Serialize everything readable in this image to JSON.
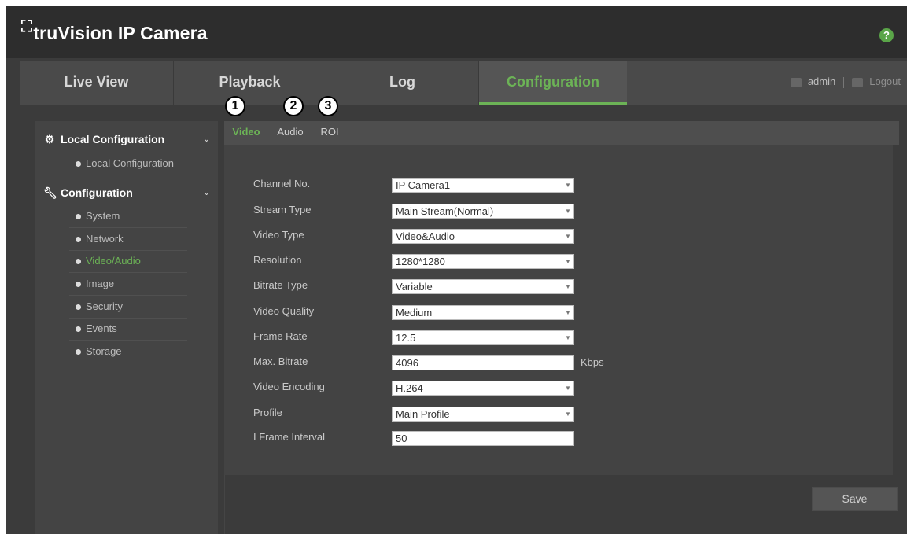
{
  "app": {
    "title": "truVision IP Camera",
    "logo_mark": "⛶",
    "help_icon": "?"
  },
  "nav": {
    "tabs": [
      "Live View",
      "Playback",
      "Log",
      "Configuration"
    ],
    "active_tab": "Configuration",
    "user": "admin",
    "logout": "Logout"
  },
  "callouts": [
    "1",
    "2",
    "3"
  ],
  "sidebar": {
    "groups": [
      {
        "label": "Local Configuration",
        "icon": "settings-icon",
        "items": [
          "Local Configuration"
        ]
      },
      {
        "label": "Configuration",
        "icon": "wrench-icon",
        "items": [
          "System",
          "Network",
          "Video/Audio",
          "Image",
          "Security",
          "Events",
          "Storage"
        ]
      }
    ],
    "active_item": "Video/Audio"
  },
  "subtabs": [
    "Video",
    "Audio",
    "ROI"
  ],
  "active_subtab": "Video",
  "form": {
    "fields": [
      {
        "label": "Channel No.",
        "value": "IP Camera1",
        "type": "select"
      },
      {
        "label": "Stream Type",
        "value": "Main Stream(Normal)",
        "type": "select"
      },
      {
        "label": "Video Type",
        "value": "Video&Audio",
        "type": "select"
      },
      {
        "label": "Resolution",
        "value": "1280*1280",
        "type": "select"
      },
      {
        "label": "Bitrate Type",
        "value": "Variable",
        "type": "select"
      },
      {
        "label": "Video Quality",
        "value": "Medium",
        "type": "select"
      },
      {
        "label": "Frame Rate",
        "value": "12.5",
        "type": "select"
      },
      {
        "label": "Max. Bitrate",
        "value": "4096",
        "type": "text",
        "unit": "Kbps"
      },
      {
        "label": "Video Encoding",
        "value": "H.264",
        "type": "select"
      },
      {
        "label": "Profile",
        "value": "Main Profile",
        "type": "select"
      },
      {
        "label": "I Frame Interval",
        "value": "50",
        "type": "text"
      }
    ]
  },
  "save_label": "Save",
  "colors": {
    "accent": "#6cb356",
    "background": "#3b3b3b",
    "titlebar": "#2d2d2d"
  }
}
